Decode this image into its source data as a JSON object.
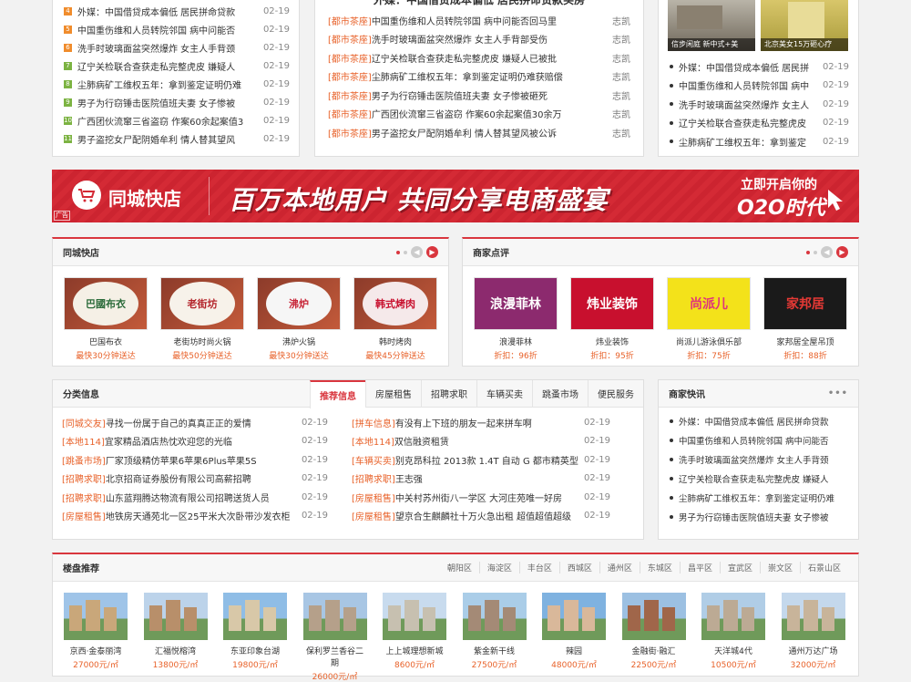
{
  "top_left_list": [
    {
      "n": "4",
      "c": "o",
      "text": "外媒：中国借贷成本偏低 居民拼命贷款",
      "date": "02-19"
    },
    {
      "n": "5",
      "c": "o",
      "text": "中国重伤维和人员转院邻国 病中问能否",
      "date": "02-19"
    },
    {
      "n": "6",
      "c": "o",
      "text": "洗手时玻璃面盆突然爆炸 女主人手背颈",
      "date": "02-19"
    },
    {
      "n": "7",
      "c": "g",
      "text": "辽宁关检联合查获走私完整虎皮 嫌疑人",
      "date": "02-19"
    },
    {
      "n": "8",
      "c": "g",
      "text": "尘肺病矿工维权五年：拿到鉴定证明仍难",
      "date": "02-19"
    },
    {
      "n": "9",
      "c": "g",
      "text": "男子为行窃锤击医院值班夫妻 女子惨被",
      "date": "02-19"
    },
    {
      "n": "10",
      "c": "g",
      "text": "广西团伙流窜三省盗窃 作案60余起案值3",
      "date": "02-19"
    },
    {
      "n": "11",
      "c": "g",
      "text": "男子盗挖女尸配阴婚牟利 情人替其望风",
      "date": "02-19"
    }
  ],
  "top_mid_headline": "外媒：中国借贷成本偏低 居民拼命贷款买房",
  "top_mid_list": [
    {
      "tag": "[都市茶座]",
      "text": "中国重伤维和人员转院邻国 病中问能否回马里",
      "author": "志凯"
    },
    {
      "tag": "[都市茶座]",
      "text": "洗手时玻璃面盆突然爆炸 女主人手背部受伤",
      "author": "志凯"
    },
    {
      "tag": "[都市茶座]",
      "text": "辽宁关检联合查获走私完整虎皮 嫌疑人已被批",
      "author": "志凯"
    },
    {
      "tag": "[都市茶座]",
      "text": "尘肺病矿工维权五年：拿到鉴定证明仍难获赔偿",
      "author": "志凯"
    },
    {
      "tag": "[都市茶座]",
      "text": "男子为行窃锤击医院值班夫妻 女子惨被砸死",
      "author": "志凯"
    },
    {
      "tag": "[都市茶座]",
      "text": "广西团伙流窜三省盗窃 作案60余起案值30余万",
      "author": "志凯"
    },
    {
      "tag": "[都市茶座]",
      "text": "男子盗挖女尸配阴婚牟利 情人替其望风被公诉",
      "author": "志凯"
    }
  ],
  "top_right_photos": [
    {
      "caption": "信步闲庭 新中式+美"
    },
    {
      "caption": "北京美女15万砸心疗"
    }
  ],
  "top_right_list": [
    {
      "text": "外媒：中国借贷成本偏低 居民拼",
      "date": "02-19"
    },
    {
      "text": "中国重伤维和人员转院邻国 病中",
      "date": "02-19"
    },
    {
      "text": "洗手时玻璃面盆突然爆炸 女主人",
      "date": "02-19"
    },
    {
      "text": "辽宁关检联合查获走私完整虎皮",
      "date": "02-19"
    },
    {
      "text": "尘肺病矿工维权五年：拿到鉴定",
      "date": "02-19"
    }
  ],
  "banner": {
    "brand": "同城快店",
    "slogan": "百万本地用户 共同分享电商盛宴",
    "cta_top": "立即开启你的",
    "cta_bottom": "O2O时代",
    "ad": "广告",
    "bg": "#d42a35"
  },
  "kuaidian": {
    "title": "同城快店",
    "items": [
      {
        "logo": "巴國布衣",
        "name": "巴国布衣",
        "sub": "最快30分钟送达"
      },
      {
        "logo": "老街坊",
        "name": "老街坊时尚火锅",
        "sub": "最快50分钟送达"
      },
      {
        "logo": "沸炉",
        "name": "沸炉火锅",
        "sub": "最快30分钟送达"
      },
      {
        "logo": "韩式烤肉",
        "name": "韩时烤肉",
        "sub": "最快45分钟送达"
      }
    ]
  },
  "dianping": {
    "title": "商家点评",
    "items": [
      {
        "logo": "浪漫菲林",
        "name": "浪漫菲林",
        "sub": "折扣：96折",
        "bg": "#8c2a6e",
        "fg": "#fff"
      },
      {
        "logo": "炜业装饰",
        "name": "炜业装饰",
        "sub": "折扣：95折",
        "bg": "#c8102e",
        "fg": "#fff"
      },
      {
        "logo": "尚派儿",
        "name": "尚派儿游泳俱乐部",
        "sub": "折扣：75折",
        "bg": "#f3e21a",
        "fg": "#e0337b"
      },
      {
        "logo": "家邦居",
        "name": "家邦居全屋吊顶",
        "sub": "折扣：88折",
        "bg": "#1a1a1a",
        "fg": "#e53935"
      }
    ]
  },
  "fenlei": {
    "title": "分类信息",
    "tabs": [
      "推荐信息",
      "房屋租售",
      "招聘求职",
      "车辆买卖",
      "跳蚤市场",
      "便民服务"
    ],
    "left": [
      {
        "tag": "[同城交友]",
        "text": "寻找一份属于自己的真真正正的爱情",
        "date": "02-19"
      },
      {
        "tag": "[本地114]",
        "text": "宜家精品酒店热忱欢迎您的光临",
        "date": "02-19"
      },
      {
        "tag": "[跳蚤市场]",
        "text": "厂家顶级精仿苹果6苹果6Plus苹果5S",
        "date": "02-19"
      },
      {
        "tag": "[招聘求职]",
        "text": "北京招商证券股份有限公司高薪招聘",
        "date": "02-19"
      },
      {
        "tag": "[招聘求职]",
        "text": "山东蓝翔腾达物流有限公司招聘送货人员",
        "date": "02-19"
      },
      {
        "tag": "[房屋租售]",
        "text": "地铁房天通苑北一区25平米大次卧带沙发衣柜",
        "date": "02-19"
      }
    ],
    "right": [
      {
        "tag": "[拼车信息]",
        "text": "有没有上下班的朋友一起来拼车啊",
        "date": "02-19"
      },
      {
        "tag": "[本地114]",
        "text": "双信融资租赁",
        "date": "02-19"
      },
      {
        "tag": "[车辆买卖]",
        "text": "别克昂科拉 2013款 1.4T 自动 G 都市精英型",
        "date": "02-19"
      },
      {
        "tag": "[招聘求职]",
        "text": "王志强",
        "date": "02-19"
      },
      {
        "tag": "[房屋租售]",
        "text": "中关村苏州街八一学区 大河庄苑唯一好房",
        "date": "02-19"
      },
      {
        "tag": "[房屋租售]",
        "text": "望京合生麒麟社十万火急出租 超值超值超级",
        "date": "02-19"
      }
    ]
  },
  "kuaixun": {
    "title": "商家快讯",
    "more": "•••",
    "items": [
      "外媒：中国借贷成本偏低 居民拼命贷款",
      "中国重伤维和人员转院邻国 病中问能否",
      "洗手时玻璃面盆突然爆炸 女主人手背颈",
      "辽宁关检联合查获走私完整虎皮 嫌疑人",
      "尘肺病矿工维权五年：拿到鉴定证明仍难",
      "男子为行窃锤击医院值班夫妻 女子惨被"
    ]
  },
  "loupan": {
    "title": "楼盘推荐",
    "areas": [
      "朝阳区",
      "海淀区",
      "丰台区",
      "西城区",
      "通州区",
      "东城区",
      "昌平区",
      "宣武区",
      "崇文区",
      "石景山区"
    ],
    "items": [
      {
        "name": "京西·金泰丽湾",
        "price": "27000元/㎡"
      },
      {
        "name": "汇福悦榕湾",
        "price": "13800元/㎡"
      },
      {
        "name": "东亚印象台湖",
        "price": "19800元/㎡"
      },
      {
        "name": "保利罗兰香谷二期",
        "price": "26000元/㎡"
      },
      {
        "name": "上上城理想新城",
        "price": "8600元/㎡"
      },
      {
        "name": "紫金新干线",
        "price": "27500元/㎡"
      },
      {
        "name": "辣园",
        "price": "48000元/㎡"
      },
      {
        "name": "金融街·融汇",
        "price": "22500元/㎡"
      },
      {
        "name": "天洋城4代",
        "price": "10500元/㎡"
      },
      {
        "name": "通州万达广场",
        "price": "32000元/㎡"
      }
    ]
  }
}
